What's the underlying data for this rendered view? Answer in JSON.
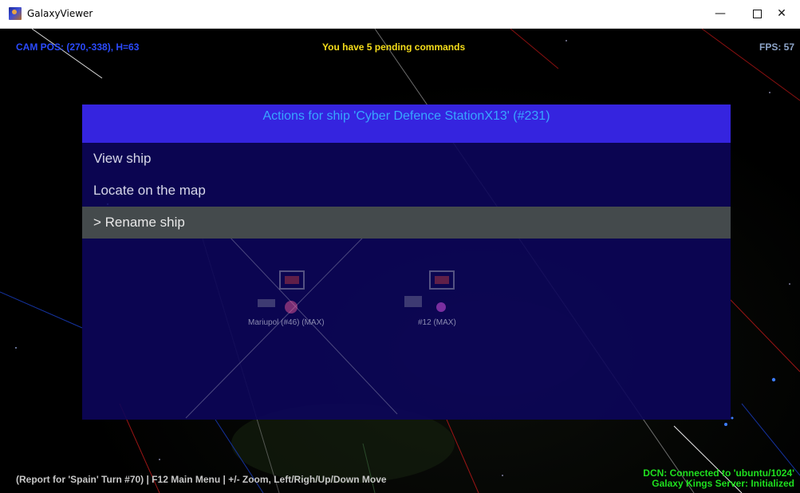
{
  "window": {
    "title": "GalaxyViewer",
    "minimize_glyph": "—",
    "close_glyph": "✕"
  },
  "hud": {
    "cam_pos": "CAM POS: (270,-338), H=63",
    "pending": "You have 5 pending commands",
    "fps": "FPS: 57",
    "report": "(Report for 'Spain' Turn #70) | F12 Main Menu | +/- Zoom, Left/Righ/Up/Down Move",
    "dcn_line1": "DCN: Connected to 'ubuntu/1024'",
    "dcn_line2": "Galaxy Kings Server: Initialized"
  },
  "dialog": {
    "title": "Actions for ship 'Cyber Defence StationX13' (#231)",
    "items": [
      {
        "label": "View ship"
      },
      {
        "label": "Locate on the map"
      },
      {
        "label": "> Rename ship"
      }
    ]
  },
  "map_objects": [
    {
      "label": "Mariupol (#46) (MAX)"
    },
    {
      "label": "#12 (MAX)"
    }
  ],
  "colors": {
    "cam_text": "#2b4bff",
    "pending_text": "#f5dd1a",
    "status_text": "#1fe01f",
    "dialog_header": "#3524df",
    "dialog_title": "#38a6ff",
    "selected_item": "#444a4c"
  }
}
